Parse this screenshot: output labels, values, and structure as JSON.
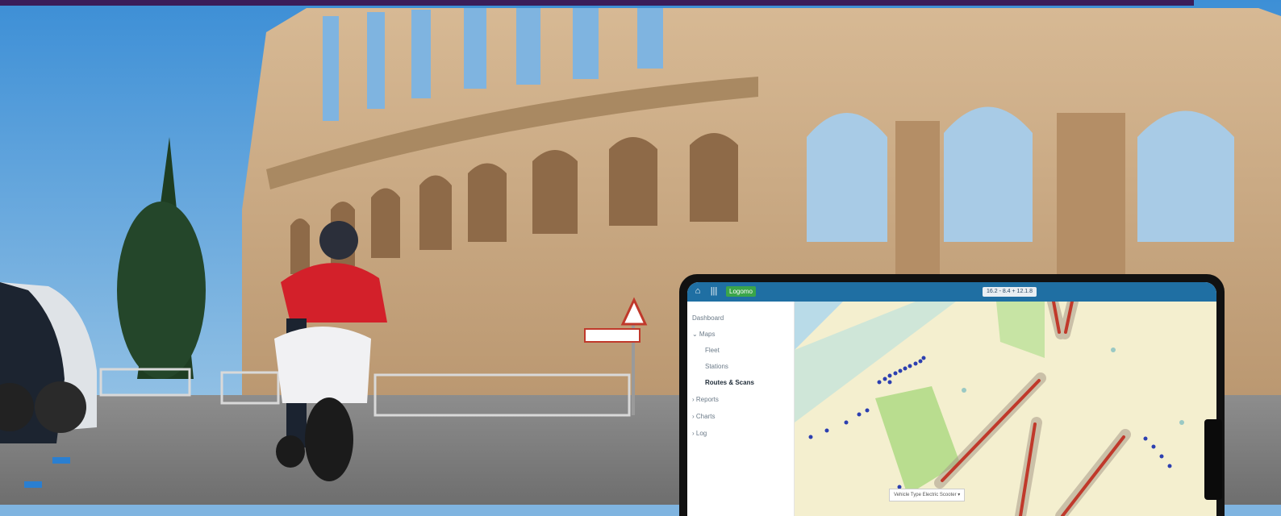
{
  "app": {
    "logo_label": "Logomo",
    "date_range": "16.2 - 8.4 + 12.1.8",
    "filter_label": "Vehicle Type    Electric Scooter  ▾"
  },
  "nav": {
    "items": [
      {
        "label": "Dashboard",
        "active": false
      },
      {
        "label": "⌄ Maps",
        "active": false
      },
      {
        "label": "Fleet",
        "active": false
      },
      {
        "label": "Stations",
        "active": false
      },
      {
        "label": "Routes & Scans",
        "active": true
      },
      {
        "label": "› Reports",
        "active": false
      },
      {
        "label": "› Charts",
        "active": false
      },
      {
        "label": "› Log",
        "active": false
      }
    ]
  },
  "icons": [
    "home-icon",
    "menu-icon"
  ],
  "colors": {
    "header": "#1f6fa3",
    "brand_bar": "#3a1d5a",
    "route": "#c0392b",
    "park": "#b9dd8f",
    "water": "#c9e7ef",
    "sky": "#7fb4e0",
    "stone": "#c7a27a"
  }
}
